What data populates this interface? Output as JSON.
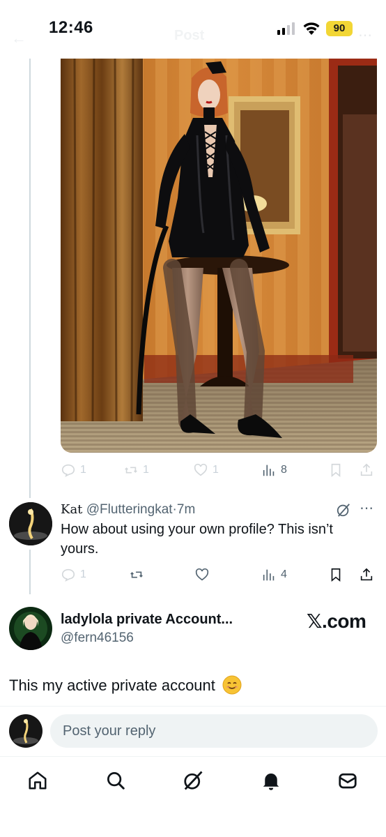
{
  "status_bar": {
    "time": "12:46",
    "battery": "90",
    "battery_color": "#f2d635"
  },
  "header": {
    "title": "Post",
    "back_icon": "arrow-left-icon",
    "more_icon": "more-icon"
  },
  "post": {
    "media_alt": "photo",
    "actions": {
      "replies": "1",
      "reposts": "1",
      "likes": "1",
      "views": "8"
    }
  },
  "reply": {
    "display_name": "Kat",
    "handle": "@Flutteringkat",
    "separator": "·",
    "time": "7m",
    "text": "How about using your own profile? This isn’t yours.",
    "actions": {
      "replies": "1",
      "views": "4"
    }
  },
  "embed": {
    "name": "ladylola private Account...",
    "handle": "@fern46156",
    "brand": "𝕏.com",
    "text": "This my active private account",
    "emoji": "smiling-face-emoji"
  },
  "composer": {
    "placeholder": "Post your reply"
  },
  "nav": {
    "items": [
      "home-icon",
      "search-icon",
      "grok-icon",
      "notifications-icon",
      "messages-icon"
    ]
  },
  "colors": {
    "text_primary": "#0f1419",
    "text_secondary": "#536471",
    "divider": "#eff3f4",
    "thread_line": "#cfd9de"
  }
}
